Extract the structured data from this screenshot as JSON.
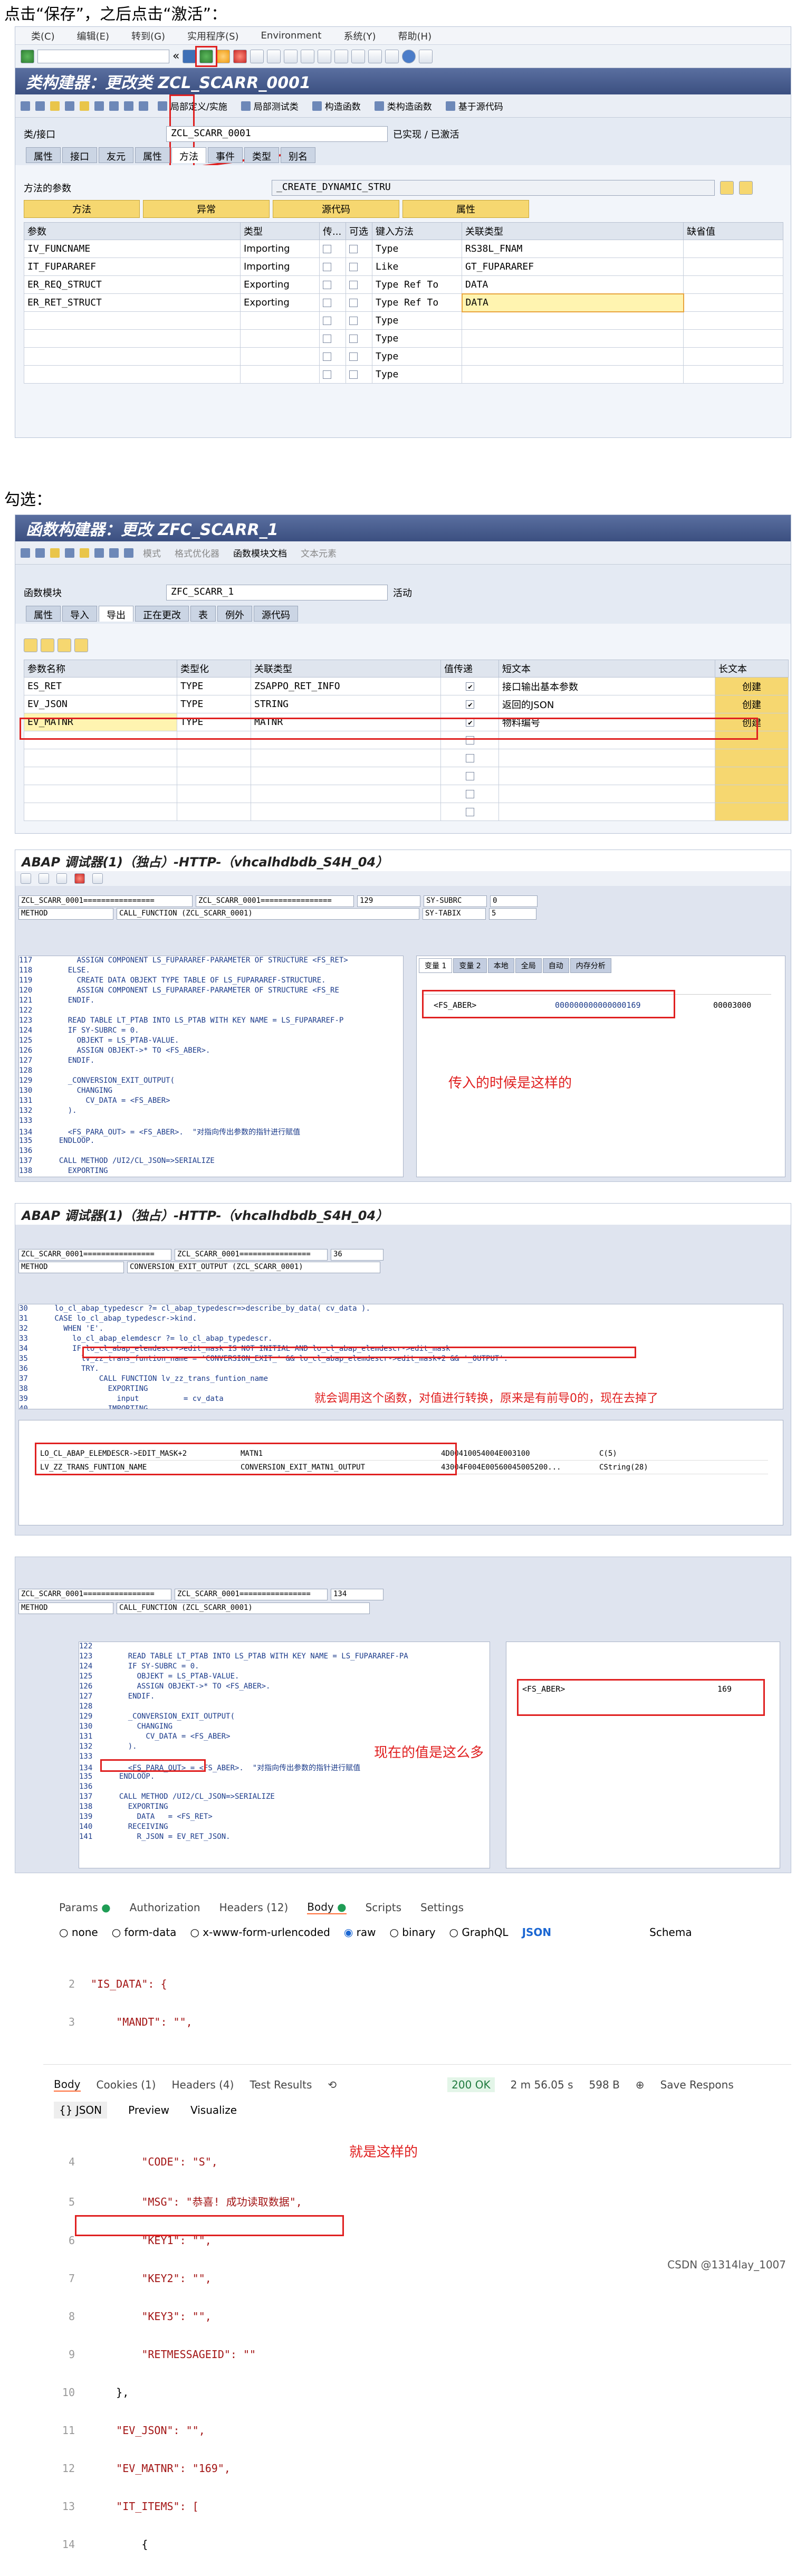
{
  "captions": {
    "c1": "点击“保存”，之后点击“激活”：",
    "c2": "勾选："
  },
  "p1": {
    "menu": [
      "类(C)",
      "编辑(E)",
      "转到(G)",
      "实用程序(S)",
      "Environment",
      "系统(Y)",
      "帮助(H)"
    ],
    "title": "类构建器：更改类 ZCL_SCARR_0001",
    "apptb": [
      "局部定义/实施",
      "局部测试类",
      "构造函数",
      "类构造函数",
      "基于源代码"
    ],
    "cls_label": "类/接口",
    "cls_value": "ZCL_SCARR_0001",
    "cls_status": "已实现 / 已激活",
    "tabs": [
      "属性",
      "接口",
      "友元",
      "属性",
      "方法",
      "事件",
      "类型",
      "别名"
    ],
    "method_label": "方法的参数",
    "method_value": "_CREATE_DYNAMIC_STRU",
    "subtabs": [
      "方法",
      "异常",
      "源代码",
      "属性"
    ],
    "cols": [
      "参数",
      "类型",
      "传...",
      "可选",
      "键入方法",
      "关联类型",
      "缺省值"
    ],
    "rows": [
      [
        "IV_FUNCNAME",
        "Importing",
        "Type",
        "RS38L_FNAM"
      ],
      [
        "IT_FUPARAREF",
        "Importing",
        "Like",
        "GT_FUPARAREF"
      ],
      [
        "ER_REQ_STRUCT",
        "Exporting",
        "Type Ref To",
        "DATA"
      ],
      [
        "ER_RET_STRUCT",
        "Exporting",
        "Type Ref To",
        "DATA"
      ],
      [
        "",
        "",
        "Type",
        ""
      ],
      [
        "",
        "",
        "Type",
        ""
      ],
      [
        "",
        "",
        "Type",
        ""
      ],
      [
        "",
        "",
        "Type",
        ""
      ]
    ]
  },
  "p2": {
    "title": "函数构建器：更改 ZFC_SCARR_1",
    "apptb": [
      "模式",
      "格式优化器",
      "函数模块文档",
      "文本元素"
    ],
    "fm_label": "函数模块",
    "fm_value": "ZFC_SCARR_1",
    "fm_status": "活动",
    "tabs": [
      "属性",
      "导入",
      "导出",
      "正在更改",
      "表",
      "例外",
      "源代码"
    ],
    "cols": [
      "参数名称",
      "类型化",
      "关联类型",
      "值传递",
      "短文本",
      "长文本"
    ],
    "rows": [
      [
        "ES_RET",
        "TYPE",
        "ZSAPPO_RET_INFO",
        "接口输出基本参数",
        "创建"
      ],
      [
        "EV_JSON",
        "TYPE",
        "STRING",
        "返回的JSON",
        "创建"
      ],
      [
        "EV_MATNR",
        "TYPE",
        "MATNR",
        "物料编号",
        "创建"
      ]
    ]
  },
  "p3": {
    "title": "ABAP 调试器(1)（独占）-HTTP-（vhcalhdbdb_S4H_04）",
    "prog": "ZCL_SCARR_0001================",
    "line": "129",
    "sysubrc": "SY-SUBRC",
    "sysubrc_v": "0",
    "systabix": "SY-TABIX",
    "systabix_v": "5",
    "method": "METHOD",
    "call": "CALL_FUNCTION (ZCL_SCARR_0001)",
    "code": [
      "117          ASSIGN COMPONENT LS_FUPARAREF-PARAMETER OF STRUCTURE <FS_RET>",
      "118        ELSE.",
      "119          CREATE DATA OBJEKT TYPE TABLE OF LS_FUPARAREF-STRUCTURE.",
      "120          ASSIGN COMPONENT LS_FUPARAREF-PARAMETER OF STRUCTURE <FS_RE",
      "121        ENDIF.",
      "122",
      "123        READ TABLE LT_PTAB INTO LS_PTAB WITH KEY NAME = LS_FUPARAREF-P",
      "124        IF SY-SUBRC = 0.",
      "125          OBJEKT = LS_PTAB-VALUE.",
      "126          ASSIGN OBJEKT->* TO <FS_ABER>.",
      "127        ENDIF.",
      "128",
      "129        _CONVERSION_EXIT_OUTPUT(",
      "130          CHANGING",
      "131            CV_DATA = <FS_ABER>",
      "132        ).",
      "133",
      "134        <FS_PARA_OUT> = <FS_ABER>.  \"对指向传出参数的指针进行赋值",
      "135      ENDLOOP.",
      "136",
      "137      CALL METHOD /UI2/CL_JSON=>SERIALIZE",
      "138        EXPORTING",
      "139          DATA   = <FS_RET>",
      "140        RECEIVING",
      "141          R_JSON = EV_RET_JSON."
    ],
    "vartabs": [
      "变量 1",
      "变量 2",
      "本地",
      "全局",
      "自动",
      "内存分析"
    ],
    "var_name": "<FS_ABER>",
    "var_value": "000000000000000169",
    "var_hex": "00003000",
    "note": "传入的时候是这样的"
  },
  "p4": {
    "title": "ABAP 调试器(1)（独占）-HTTP-（vhcalhdbdb_S4H_04）",
    "prog": "ZCL_SCARR_0001================",
    "line": "36",
    "method": "METHOD",
    "call": "CONVERSION_EXIT_OUTPUT (ZCL_SCARR_0001)",
    "code": [
      "30      lo_cl_abap_typedescr ?= cl_abap_typedescr=>describe_by_data( cv_data ).",
      "31      CASE lo_cl_abap_typedescr->kind.",
      "32        WHEN 'E'.",
      "33          lo_cl_abap_elemdescr ?= lo_cl_abap_typedescr.",
      "34          IF lo_cl_abap_elemdescr->edit_mask IS NOT INITIAL AND lo_cl_abap_elemdescr->edit_mask",
      "35            lv_zz_trans_funtion_name = 'CONVERSION_EXIT_' && lo_cl_abap_elemdescr->edit_mask+2 && '_OUTPUT'.",
      "36            TRY.",
      "37                CALL FUNCTION lv_zz_trans_funtion_name",
      "38                  EXPORTING",
      "39                    input          = cv_data",
      "40                  IMPORTING"
    ],
    "note": "就会调用这个函数，对值进行转换，原来是有前导0的，现在去掉了",
    "vars": [
      [
        "LO_CL_ABAP_ELEMDESCR->EDIT_MASK+2",
        "MATN1",
        "4D00410054004E003100",
        "C(5)"
      ],
      [
        "LV_ZZ_TRANS_FUNTION_NAME",
        "CONVERSION_EXIT_MATN1_OUTPUT",
        "43004F004E00560045005200...",
        "CString(28)"
      ]
    ]
  },
  "p5": {
    "prog": "ZCL_SCARR_0001================",
    "line": "134",
    "method": "METHOD",
    "call": "CALL_FUNCTION (ZCL_SCARR_0001)",
    "code": [
      "122",
      "123        READ TABLE LT_PTAB INTO LS_PTAB WITH KEY NAME = LS_FUPARAREF-PA",
      "124        IF SY-SUBRC = 0.",
      "125          OBJEKT = LS_PTAB-VALUE.",
      "126          ASSIGN OBJEKT->* TO <FS_ABER>.",
      "127        ENDIF.",
      "128",
      "129        _CONVERSION_EXIT_OUTPUT(",
      "130          CHANGING",
      "131            CV_DATA = <FS_ABER>",
      "132        ).",
      "133",
      "134        <FS_PARA_OUT> = <FS_ABER>.  \"对指向传出参数的指针进行赋值",
      "135      ENDLOOP.",
      "136",
      "137      CALL METHOD /UI2/CL_JSON=>SERIALIZE",
      "138        EXPORTING",
      "139          DATA   = <FS_RET>",
      "140        RECEIVING",
      "141          R_JSON = EV_RET_JSON."
    ],
    "var_name": "<FS_ABER>",
    "var_value": "169",
    "note": "现在的值是这么多"
  },
  "p6": {
    "reqtabs": [
      "Params",
      "Authorization",
      "Headers (12)",
      "Body",
      "Scripts",
      "Settings"
    ],
    "bodytypes": [
      "none",
      "form-data",
      "x-www-form-urlencoded",
      "raw",
      "binary",
      "GraphQL"
    ],
    "json": "JSON",
    "schema": "Schema",
    "req_lines": [
      [
        "2",
        "\"IS_DATA\": {"
      ],
      [
        "3",
        "    \"MANDT\": \"\","
      ]
    ],
    "resptabs": [
      "Body",
      "Cookies (1)",
      "Headers (4)",
      "Test Results"
    ],
    "status": "200 OK",
    "time": "2 m 56.05 s",
    "size": "598 B",
    "save": "Save Respons",
    "view": [
      "{} JSON",
      "Preview",
      "Visualize"
    ],
    "resp_lines": [
      [
        "4",
        "        \"CODE\": \"S\","
      ],
      [
        "5",
        "        \"MSG\": \"恭喜! 成功读取数据\","
      ],
      [
        "6",
        "        \"KEY1\": \"\","
      ],
      [
        "7",
        "        \"KEY2\": \"\","
      ],
      [
        "8",
        "        \"KEY3\": \"\","
      ],
      [
        "9",
        "        \"RETMESSAGEID\": \"\""
      ],
      [
        "10",
        "    },"
      ],
      [
        "11",
        "    \"EV_JSON\": \"\","
      ],
      [
        "12",
        "    \"EV_MATNR\": \"169\","
      ],
      [
        "13",
        "    \"IT_ITEMS\": ["
      ],
      [
        "14",
        "        {"
      ]
    ],
    "note": "就是这样的",
    "footer": "CSDN @1314lay_1007"
  }
}
